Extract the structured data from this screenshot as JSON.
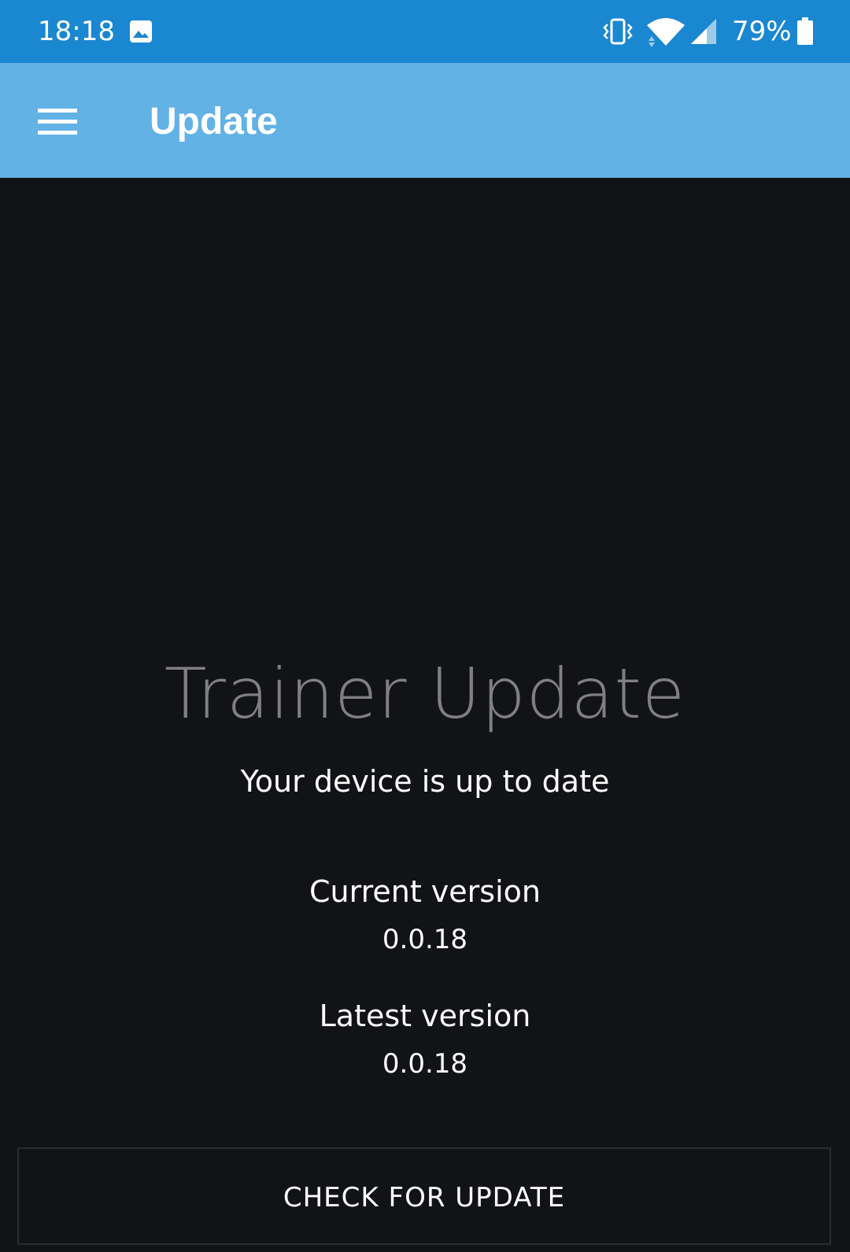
{
  "status_bar": {
    "time": "18:18",
    "battery": "79%",
    "color": "#1A87D1",
    "icons": [
      "gallery-icon",
      "vibrate-icon",
      "wifi-icon",
      "signal-icon",
      "battery-icon"
    ]
  },
  "app_bar": {
    "title": "Update",
    "color": "#62B2E5",
    "menu_icon": "hamburger-menu-icon"
  },
  "main": {
    "headline": "Trainer Update",
    "status_message": "Your device is up to date",
    "current_version_label": "Current version",
    "current_version": "0.0.18",
    "latest_version_label": "Latest version",
    "latest_version": "0.0.18",
    "check_button_label": "CHECK FOR UPDATE"
  },
  "colors": {
    "background": "#121316",
    "headline_text": "#808080",
    "body_text": "#FFFFFF"
  }
}
